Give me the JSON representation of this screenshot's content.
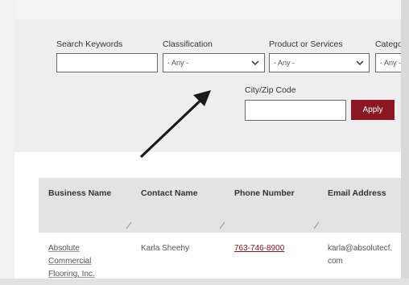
{
  "filters": {
    "search_label": "Search Keywords",
    "search_value": "",
    "classification_label": "Classification",
    "classification_value": "- Any -",
    "product_label": "Product or Services",
    "product_value": "- Any -",
    "category_label": "Catego",
    "category_value": "- Any -",
    "cityzip_label": "City/Zip Code",
    "cityzip_value": "",
    "apply_label": "Apply"
  },
  "table": {
    "columns": [
      "Business Name",
      "Contact Name",
      "Phone Number",
      "Email Address"
    ],
    "rows": [
      {
        "business_lines": [
          "Absolute",
          "Commercial",
          "Flooring, Inc."
        ],
        "contact": "Karla Sheehy",
        "phone": "763-746-8900",
        "email_lines": [
          "karla@absolutecf.",
          "com"
        ]
      }
    ]
  },
  "colors": {
    "accent": "#8b1723",
    "filter_bg": "#efefef",
    "header_bg": "#e3e3e3"
  }
}
